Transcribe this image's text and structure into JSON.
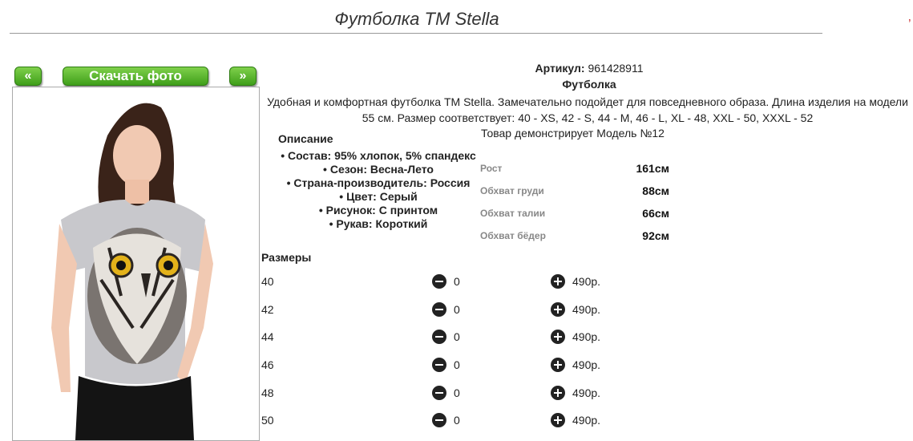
{
  "product": {
    "title": "Футболка ТМ Stella",
    "sku_label": "Артикул:",
    "sku_value": "961428911",
    "type": "Футболка",
    "description_line1": "Удобная и комфортная футболка ТМ Stella. Замечательно подойдет для повседневного образа. Длина изделия на модели",
    "description_line2": "55 см. Размер соответствует: 40 - XS, 42 - S, 44 - M, 46 - L, XL - 48, XXL - 50, XXXL - 52"
  },
  "photo_nav": {
    "prev_label": "«",
    "download_label": "Скачать фото",
    "next_label": "»"
  },
  "corner_mark": "’",
  "description": {
    "heading": "Описание",
    "items": [
      "Состав: 95% хлопок, 5% спандекс",
      "Сезон: Весна-Лето",
      "Страна-производитель: Россия",
      "Цвет: Серый",
      "Рисунок: С принтом",
      "Рукав: Короткий"
    ]
  },
  "model": {
    "caption": "Товар демонстрирует Модель №12",
    "measurements": [
      {
        "label": "Рост",
        "value": "161см"
      },
      {
        "label": "Обхват груди",
        "value": "88см"
      },
      {
        "label": "Обхват талии",
        "value": "66см"
      },
      {
        "label": "Обхват бёдер",
        "value": "92см"
      }
    ]
  },
  "sizes": {
    "heading": "Размеры",
    "rows": [
      {
        "size": "40",
        "qty": "0",
        "price": "490р."
      },
      {
        "size": "42",
        "qty": "0",
        "price": "490р."
      },
      {
        "size": "44",
        "qty": "0",
        "price": "490р."
      },
      {
        "size": "46",
        "qty": "0",
        "price": "490р."
      },
      {
        "size": "48",
        "qty": "0",
        "price": "490р."
      },
      {
        "size": "50",
        "qty": "0",
        "price": "490р."
      }
    ]
  },
  "colors": {
    "button_green": "#52b52a",
    "shirt_gray": "#c8c8cc"
  }
}
